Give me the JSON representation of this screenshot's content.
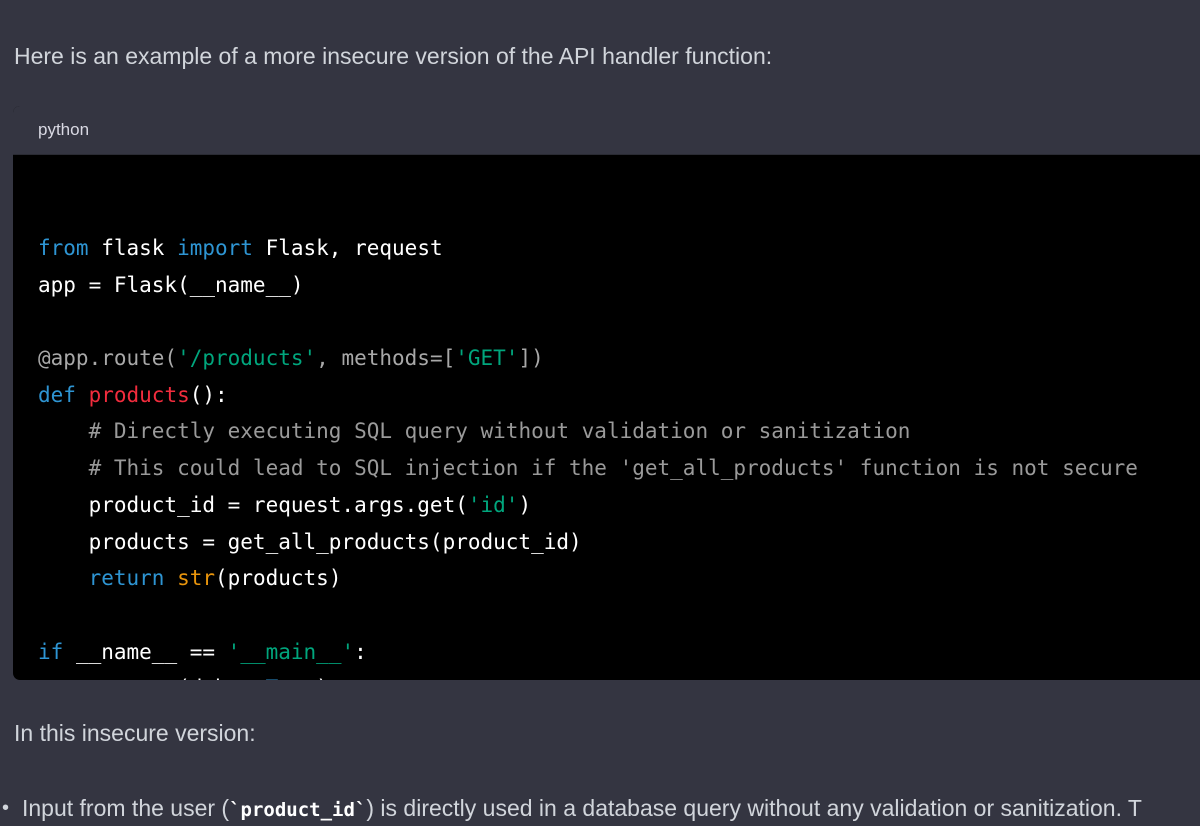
{
  "message": {
    "intro": "Here is an example of a more insecure version of the API handler function:",
    "code_block": {
      "language": "python",
      "lines": [
        [
          [
            "kw",
            "from"
          ],
          [
            "plain",
            " flask "
          ],
          [
            "kw",
            "import"
          ],
          [
            "plain",
            " Flask, request"
          ]
        ],
        [
          [
            "plain",
            "app = Flask(__name__)"
          ]
        ],
        [],
        [
          [
            "dec",
            "@app.route("
          ],
          [
            "str",
            "'/products'"
          ],
          [
            "dec",
            ", methods=["
          ],
          [
            "str",
            "'GET'"
          ],
          [
            "dec",
            "])"
          ]
        ],
        [
          [
            "kw",
            "def"
          ],
          [
            "plain",
            " "
          ],
          [
            "fn",
            "products"
          ],
          [
            "plain",
            "():"
          ]
        ],
        [
          [
            "plain",
            "    "
          ],
          [
            "com",
            "# Directly executing SQL query without validation or sanitization"
          ]
        ],
        [
          [
            "plain",
            "    "
          ],
          [
            "com",
            "# This could lead to SQL injection if the 'get_all_products' function is not secure"
          ]
        ],
        [
          [
            "plain",
            "    product_id = request.args.get("
          ],
          [
            "str",
            "'id'"
          ],
          [
            "plain",
            ")"
          ]
        ],
        [
          [
            "plain",
            "    products = get_all_products(product_id)"
          ]
        ],
        [
          [
            "plain",
            "    "
          ],
          [
            "kw",
            "return"
          ],
          [
            "plain",
            " "
          ],
          [
            "bi",
            "str"
          ],
          [
            "plain",
            "(products)"
          ]
        ],
        [],
        [
          [
            "kw",
            "if"
          ],
          [
            "plain",
            " __name__ == "
          ],
          [
            "str",
            "'__main__'"
          ],
          [
            "plain",
            ":"
          ]
        ],
        [
          [
            "plain",
            "    app.run(debug="
          ],
          [
            "kw",
            "True"
          ],
          [
            "plain",
            ")"
          ]
        ]
      ]
    },
    "heading": "In this insecure version:",
    "bullet": {
      "marker": "•",
      "prefix": "Input from the user (",
      "code": "`product_id`",
      "suffix": ") is directly used in a database query without any validation or sanitization. T"
    }
  },
  "colors": {
    "background": "#343541",
    "code_background": "#000000",
    "keyword": "#2e95d3",
    "function_name": "#f22c3d",
    "string": "#00a67d",
    "builtin": "#e9950c",
    "comment": "#9a9a9a"
  }
}
